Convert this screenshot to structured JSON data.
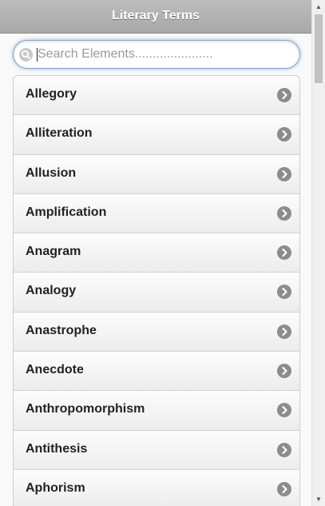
{
  "header": {
    "title": "Literary Terms"
  },
  "search": {
    "placeholder": "Search Elements......................"
  },
  "list": {
    "items": [
      {
        "label": "Allegory"
      },
      {
        "label": "Alliteration"
      },
      {
        "label": "Allusion"
      },
      {
        "label": "Amplification"
      },
      {
        "label": "Anagram"
      },
      {
        "label": "Analogy"
      },
      {
        "label": "Anastrophe"
      },
      {
        "label": "Anecdote"
      },
      {
        "label": "Anthropomorphism"
      },
      {
        "label": "Antithesis"
      },
      {
        "label": "Aphorism"
      }
    ]
  },
  "icons": {
    "search": "search-icon",
    "row_arrow": "chevron-right-circle-icon",
    "scroll_up": "scroll-up-arrow-icon",
    "scroll_down": "scroll-down-arrow-icon"
  },
  "colors": {
    "header_bg": "#b3b3b3",
    "search_focus": "#3881cc",
    "row_text": "#222222",
    "arrow_bg": "#8c8c8c"
  }
}
